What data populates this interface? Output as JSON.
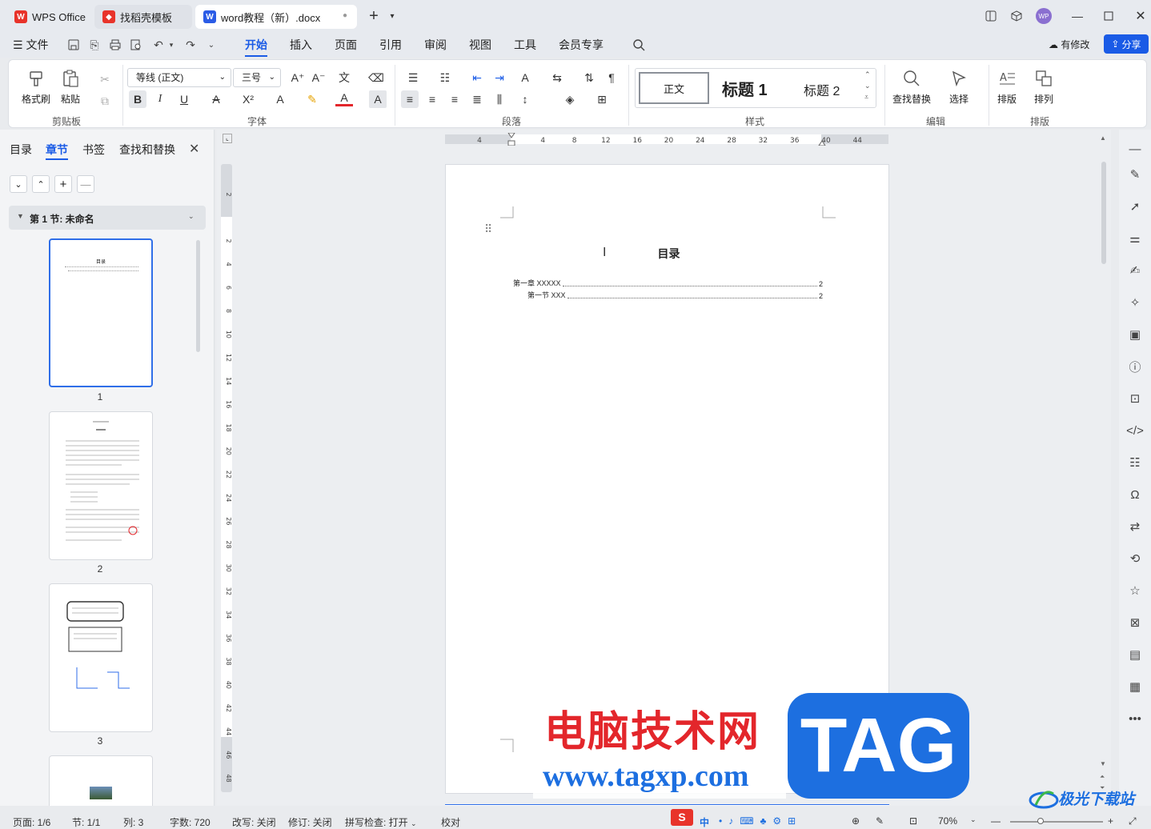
{
  "tabs": [
    {
      "label": "WPS Office"
    },
    {
      "label": "找稻壳模板"
    },
    {
      "label": "word教程（新）.docx"
    }
  ],
  "avatar_text": "WP",
  "menu": {
    "file": "文件",
    "items": [
      "开始",
      "插入",
      "页面",
      "引用",
      "审阅",
      "视图",
      "工具",
      "会员专享"
    ],
    "active": "开始",
    "modified": "有修改",
    "share": "分享"
  },
  "ribbon": {
    "format_painter": "格式刷",
    "paste": "粘贴",
    "font_name": "等线 (正文)",
    "font_size": "三号",
    "styles": {
      "normal": "正文",
      "h1": "标题 1",
      "h2": "标题 2"
    },
    "find_replace": "查找替换",
    "select": "选择",
    "layout": "排版",
    "arrange": "排列",
    "groups": [
      "剪贴板",
      "字体",
      "段落",
      "样式",
      "编辑",
      "排版"
    ]
  },
  "left_panel": {
    "tabs": [
      "目录",
      "章节",
      "书签",
      "查找和替换"
    ],
    "active_tab": "章节",
    "section_title": "第 1 节: 未命名",
    "thumb_title": "目录",
    "page_numbers": [
      "1",
      "2",
      "3"
    ]
  },
  "ruler": {
    "h_ticks": [
      "4",
      "4",
      "8",
      "12",
      "16",
      "20",
      "24",
      "28",
      "32",
      "36",
      "40",
      "44"
    ],
    "v_ticks": [
      "2",
      "2",
      "4",
      "6",
      "8",
      "10",
      "12",
      "14",
      "16",
      "18",
      "20",
      "22",
      "24",
      "26",
      "28",
      "30",
      "32",
      "34",
      "36",
      "38",
      "40",
      "42",
      "44",
      "46",
      "48"
    ]
  },
  "document": {
    "title": "目录",
    "toc": [
      {
        "text": "第一章 XXXXX",
        "page": "2"
      },
      {
        "text": "第一节 XXX",
        "page": "2"
      }
    ]
  },
  "watermark": {
    "cn": "电脑技术网",
    "url": "www.tagxp.com",
    "tag": "TAG",
    "corner": "极光下载站"
  },
  "status": {
    "page": "页面: 1/6",
    "section": "节: 1/1",
    "column": "列: 3",
    "words": "字数: 720",
    "overtype": "改写: 关闭",
    "revision": "修订: 关闭",
    "spell": "拼写检查: 打开",
    "proof": "校对",
    "zoom": "70%",
    "ime": "中"
  },
  "colors": {
    "accent": "#1a5be6",
    "wps_red": "#e8332a",
    "tag_blue": "#1d6fe0",
    "watermark_red": "#e3262b"
  }
}
